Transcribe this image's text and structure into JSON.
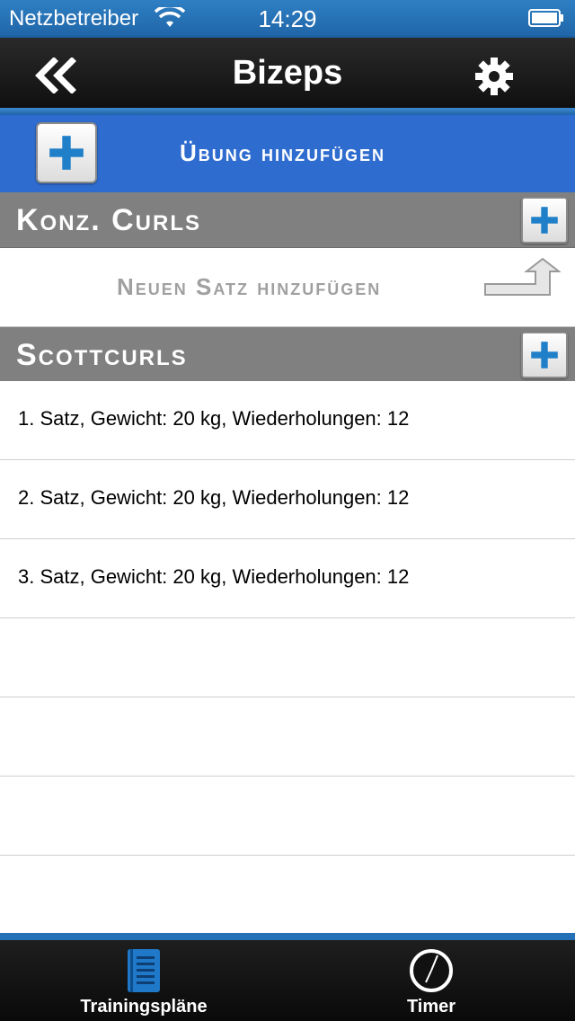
{
  "status_bar": {
    "carrier": "Netzbetreiber",
    "time": "14:29",
    "wifi_icon": "wifi-icon",
    "battery_icon": "battery-icon"
  },
  "nav": {
    "title": "Bizeps",
    "back_icon": "double-chevron-left-icon",
    "settings_icon": "gear-icon"
  },
  "add_exercise": {
    "label": "Übung hinzufügen",
    "icon": "plus-icon"
  },
  "sections": [
    {
      "title": "Konz. Curls",
      "add_set_label": "Neuen Satz hinzufügen",
      "sets": []
    },
    {
      "title": "Scottcurls",
      "sets": [
        "1. Satz, Gewicht: 20 kg, Wiederholungen: 12",
        "2. Satz, Gewicht: 20 kg, Wiederholungen: 12",
        "3. Satz, Gewicht: 20 kg, Wiederholungen: 12"
      ]
    }
  ],
  "tabs": [
    {
      "label": "Trainingspläne",
      "icon": "document-list-icon",
      "selected": true
    },
    {
      "label": "Timer",
      "icon": "clock-icon",
      "selected": false
    }
  ],
  "colors": {
    "accent_blue": "#2f6ccf",
    "section_gray": "#808080",
    "tab_active_blue": "#2470b6"
  }
}
